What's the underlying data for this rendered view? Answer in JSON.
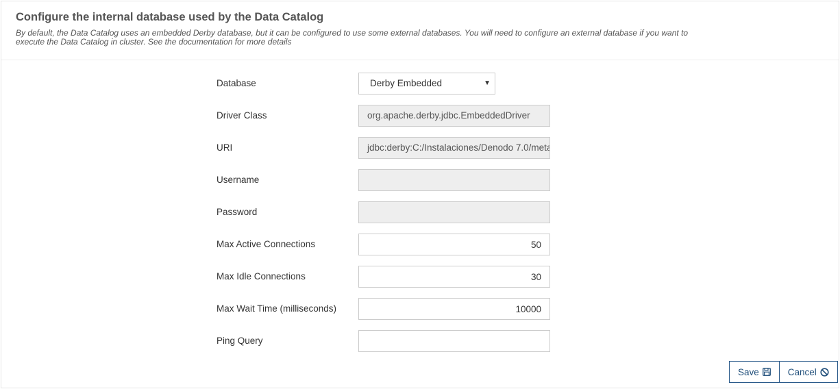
{
  "header": {
    "title": "Configure the internal database used by the Data Catalog",
    "description": "By default, the Data Catalog uses an embedded Derby database, but it can be configured to use some external databases. You will need to configure an external database if you want to execute the Data Catalog in cluster. See the documentation for more details"
  },
  "form": {
    "database": {
      "label": "Database",
      "value": "Derby Embedded"
    },
    "driver_class": {
      "label": "Driver Class",
      "value": "org.apache.derby.jdbc.EmbeddedDriver"
    },
    "uri": {
      "label": "URI",
      "value": "jdbc:derby:C:/Instalaciones/Denodo 7.0/meta"
    },
    "username": {
      "label": "Username",
      "value": ""
    },
    "password": {
      "label": "Password",
      "value": ""
    },
    "max_active": {
      "label": "Max Active Connections",
      "value": "50"
    },
    "max_idle": {
      "label": "Max Idle Connections",
      "value": "30"
    },
    "max_wait": {
      "label": "Max Wait Time (milliseconds)",
      "value": "10000"
    },
    "ping_query": {
      "label": "Ping Query",
      "value": ""
    }
  },
  "actions": {
    "save_label": "Save",
    "cancel_label": "Cancel"
  },
  "colors": {
    "button_border": "#2a5a8a",
    "button_text": "#1f4e7a",
    "disabled_bg": "#eeeeee"
  }
}
